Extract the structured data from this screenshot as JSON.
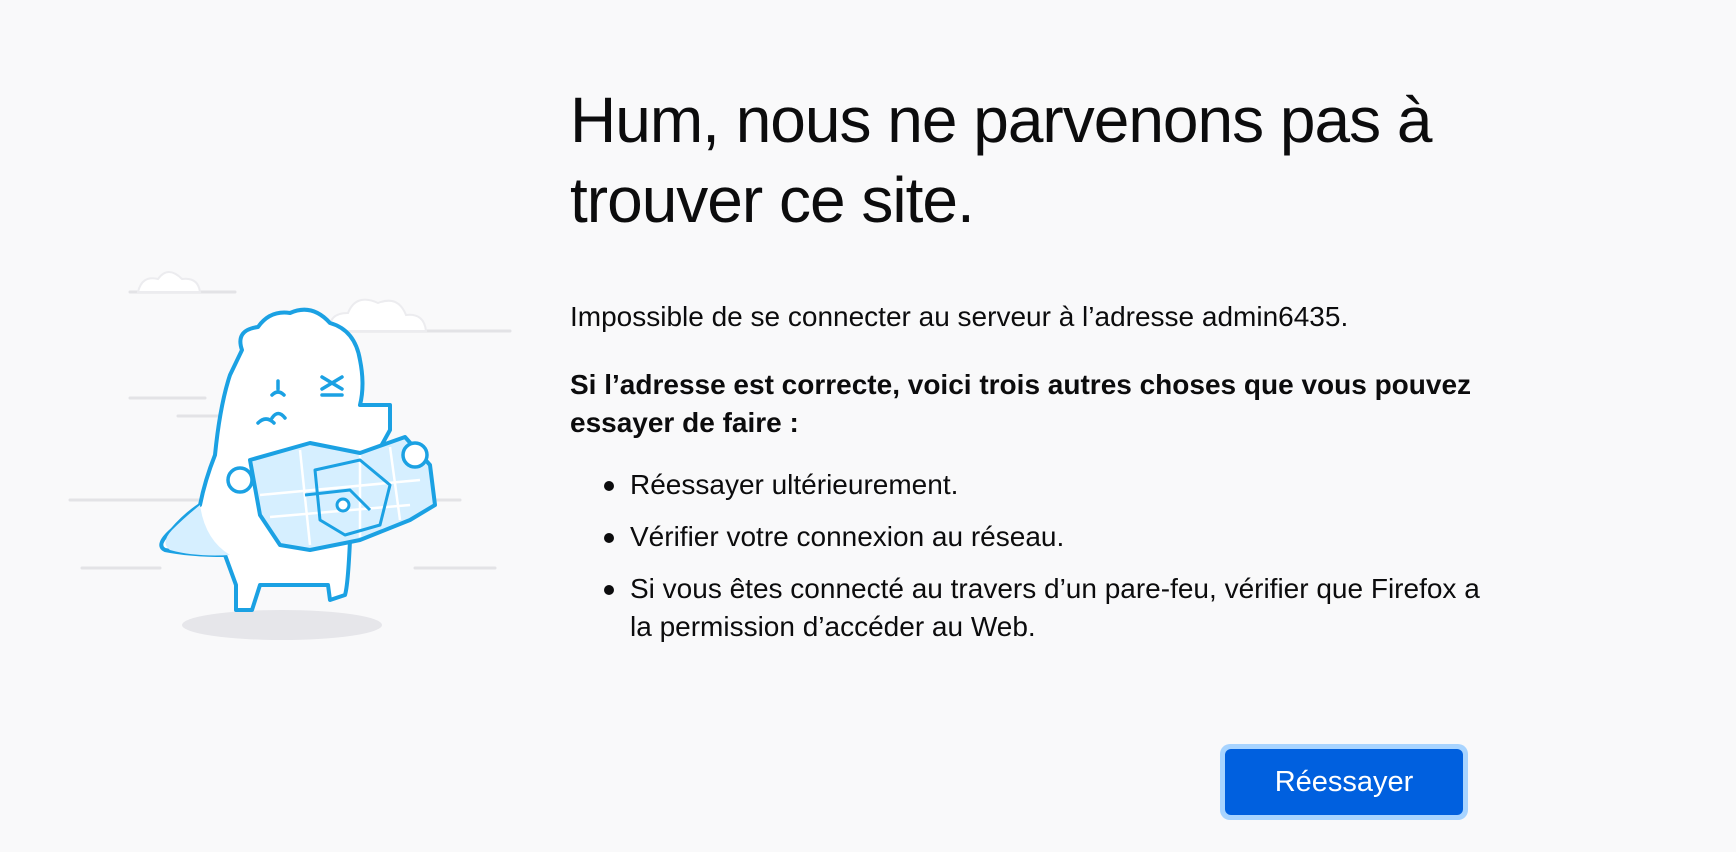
{
  "error": {
    "title": "Hum, nous ne parvenons pas à trouver ce site.",
    "description": "Impossible de se connecter au serveur à l’adresse admin6435.",
    "suggestions_heading": "Si l’adresse est correcte, voici trois autres choses que vous pouvez essayer de faire :",
    "suggestions": [
      "Réessayer ultérieurement.",
      "Vérifier votre connexion au réseau.",
      "Si vous êtes connecté au travers d’un pare-feu, vérifier que Firefox a la permission d’accéder au Web."
    ],
    "retry_label": "Réessayer"
  },
  "illustration": {
    "icon": "confused-monster-with-map-illustration"
  },
  "colors": {
    "background": "#f9f9fa",
    "text": "#0c0c0d",
    "button": "#0060df",
    "button_focus_ring": "#a8d4ff",
    "illustration_outline": "#1ba1e3",
    "illustration_fill": "#d6efff"
  }
}
